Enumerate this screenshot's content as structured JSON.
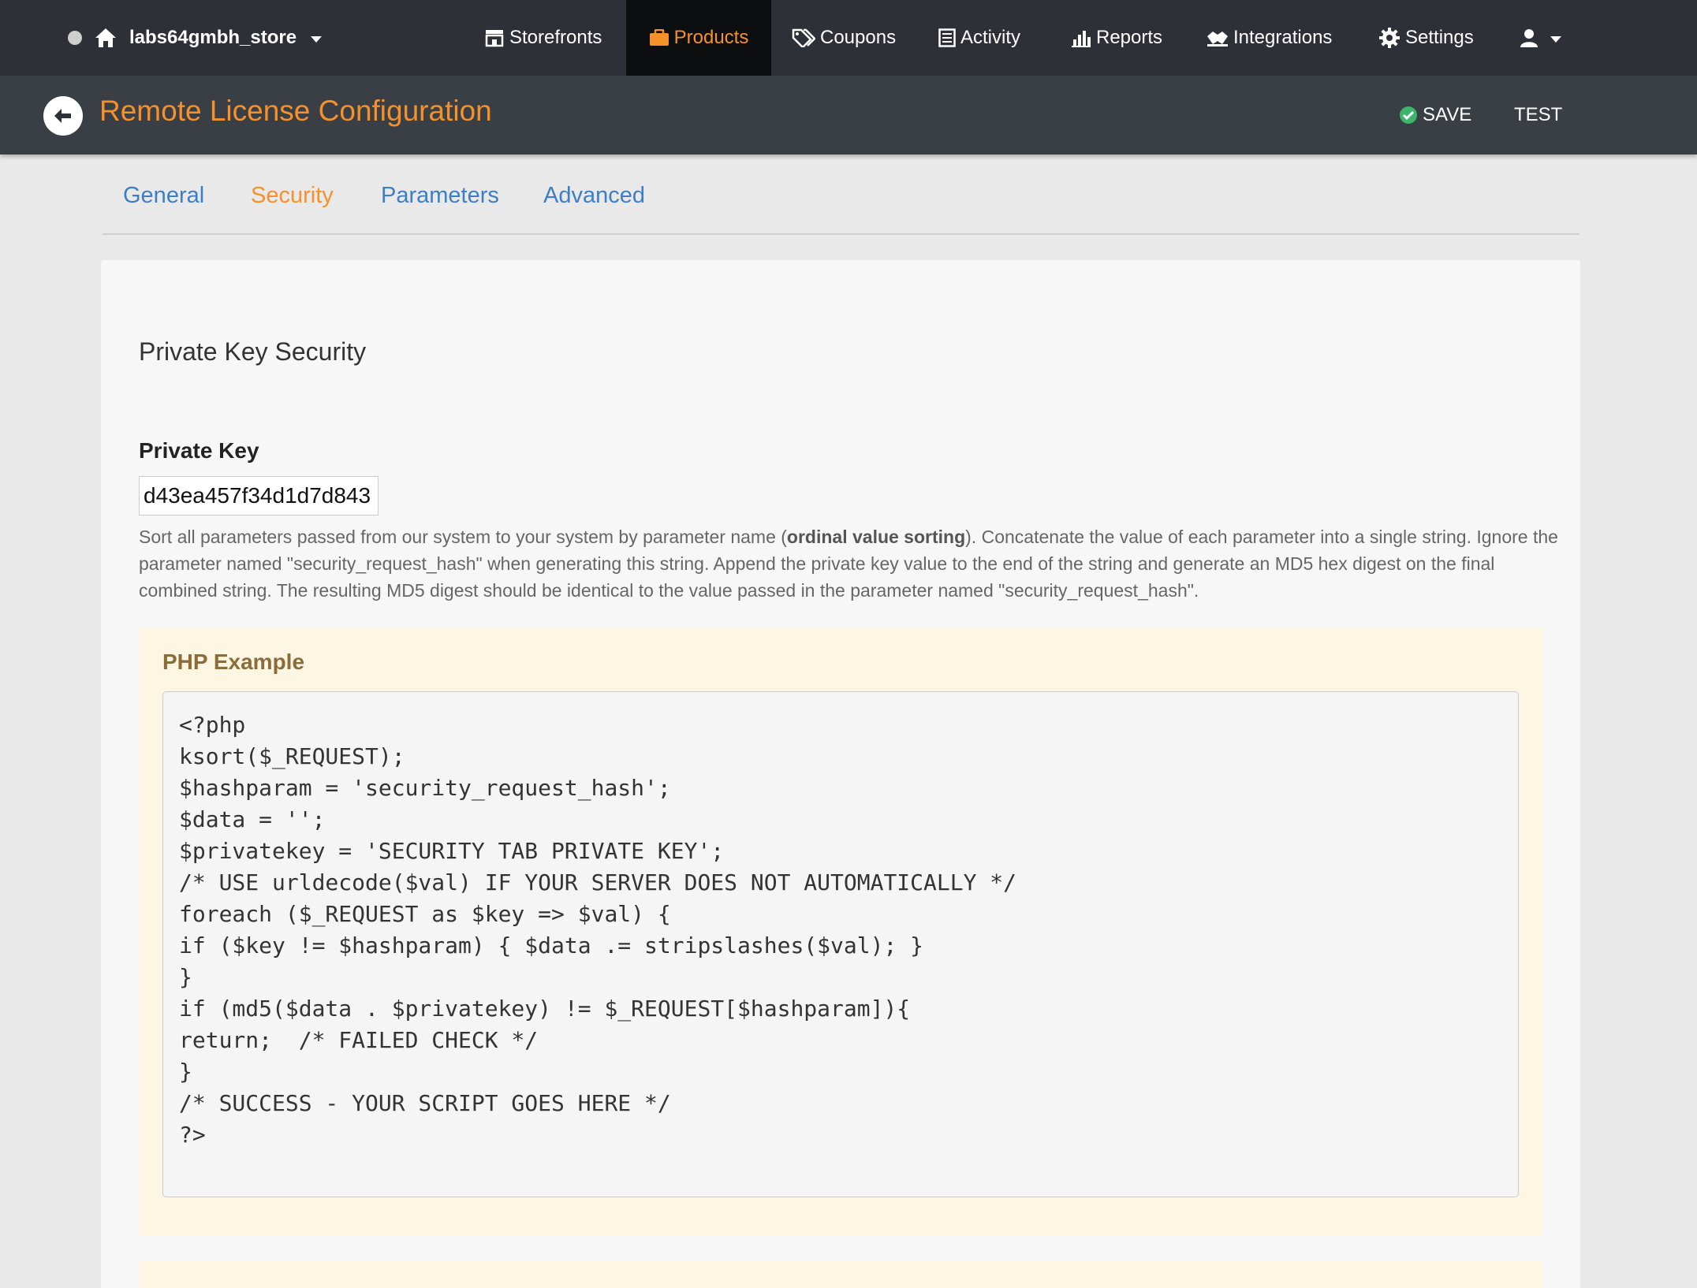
{
  "topnav": {
    "store_name": "labs64gmbh_store",
    "items": [
      {
        "label": "Storefronts",
        "icon": "storefront-icon"
      },
      {
        "label": "Products",
        "icon": "briefcase-icon",
        "active": true
      },
      {
        "label": "Coupons",
        "icon": "tags-icon"
      },
      {
        "label": "Activity",
        "icon": "list-icon"
      },
      {
        "label": "Reports",
        "icon": "bar-chart-icon"
      },
      {
        "label": "Integrations",
        "icon": "handshake-icon"
      },
      {
        "label": "Settings",
        "icon": "gear-icon"
      }
    ],
    "accent_color": "#f5912b"
  },
  "header": {
    "title": "Remote License Configuration",
    "save_label": "SAVE",
    "test_label": "TEST"
  },
  "tabs": [
    {
      "label": "General"
    },
    {
      "label": "Security",
      "active": true
    },
    {
      "label": "Parameters"
    },
    {
      "label": "Advanced"
    }
  ],
  "main": {
    "section_title": "Private Key Security",
    "private_key_label": "Private Key",
    "private_key_value": "d43ea457f34d1d7d843",
    "help": {
      "part1": "Sort all parameters passed from our system to your system by parameter name (",
      "bold": "ordinal value sorting",
      "part2": "). Concatenate the value of each parameter into a single string. Ignore the parameter named \"security_request_hash\" when generating this string. Append the private key value to the end of the string and generate an MD5 hex digest on the final combined string. The resulting MD5 digest should be identical to the value passed in the parameter named \"security_request_hash\"."
    },
    "example_title": "PHP Example",
    "code_lines": [
      "<?php",
      "ksort($_REQUEST);",
      "$hashparam = 'security_request_hash';",
      "$data = '';",
      "$privatekey = 'SECURITY TAB PRIVATE KEY';",
      "/* USE urldecode($val) IF YOUR SERVER DOES NOT AUTOMATICALLY */",
      "foreach ($_REQUEST as $key => $val) {",
      "if ($key != $hashparam) { $data .= stripslashes($val); }",
      "}",
      "if (md5($data . $privatekey) != $_REQUEST[$hashparam]){",
      "return;  /* FAILED CHECK */",
      "}",
      "/* SUCCESS - YOUR SCRIPT GOES HERE */",
      "?>"
    ]
  }
}
